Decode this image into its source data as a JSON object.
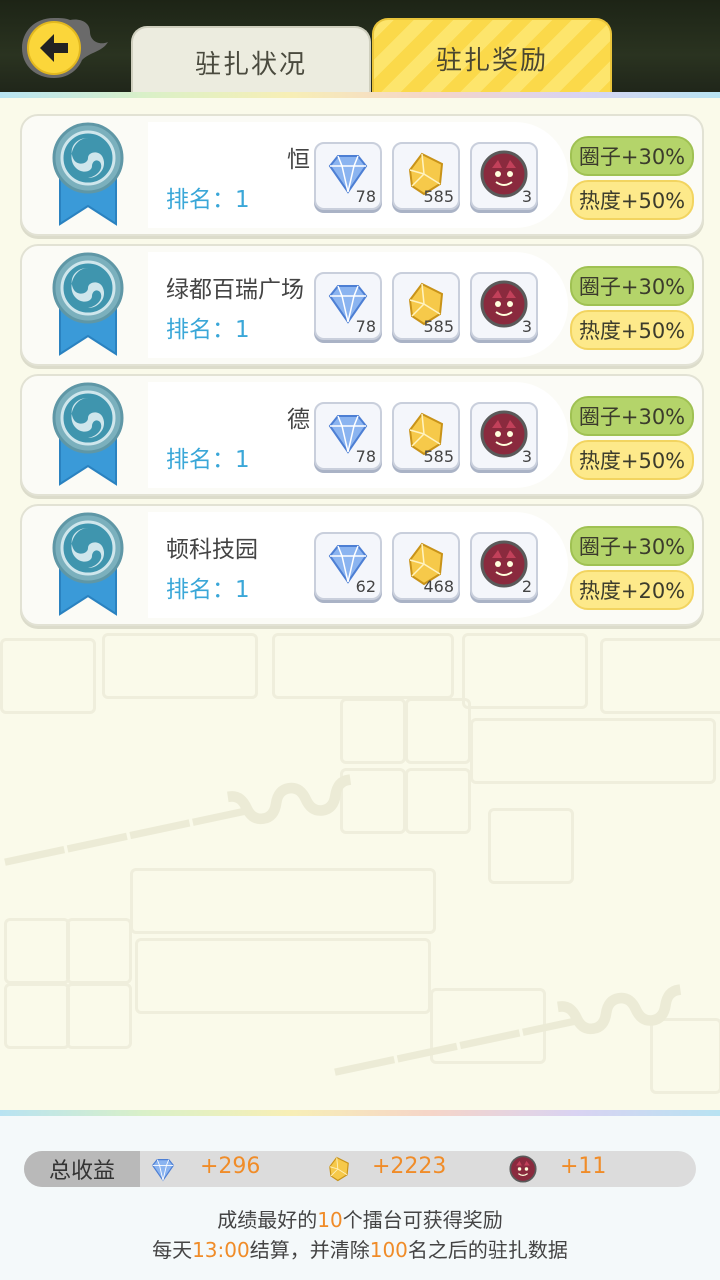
{
  "header": {
    "back_icon": "back-arrow-icon",
    "tabs": [
      {
        "label": "驻扎状况",
        "active": false
      },
      {
        "label": "驻扎奖励",
        "active": true
      }
    ]
  },
  "cards": [
    {
      "name": "恒",
      "rank_label": "排名：1",
      "items": [
        {
          "icon": "diamond-icon",
          "qty": "78"
        },
        {
          "icon": "gold-crystal-icon",
          "qty": "585"
        },
        {
          "icon": "monster-token-icon",
          "qty": "3"
        }
      ],
      "bonus_circle": "圈子+30%",
      "bonus_heat": "热度+50%"
    },
    {
      "name": "绿都百瑞广场",
      "rank_label": "排名：1",
      "items": [
        {
          "icon": "diamond-icon",
          "qty": "78"
        },
        {
          "icon": "gold-crystal-icon",
          "qty": "585"
        },
        {
          "icon": "monster-token-icon",
          "qty": "3"
        }
      ],
      "bonus_circle": "圈子+30%",
      "bonus_heat": "热度+50%"
    },
    {
      "name": "德",
      "rank_label": "排名：1",
      "items": [
        {
          "icon": "diamond-icon",
          "qty": "78"
        },
        {
          "icon": "gold-crystal-icon",
          "qty": "585"
        },
        {
          "icon": "monster-token-icon",
          "qty": "3"
        }
      ],
      "bonus_circle": "圈子+30%",
      "bonus_heat": "热度+50%"
    },
    {
      "name": "顿科技园",
      "rank_label": "排名：1",
      "items": [
        {
          "icon": "diamond-icon",
          "qty": "62"
        },
        {
          "icon": "gold-crystal-icon",
          "qty": "468"
        },
        {
          "icon": "monster-token-icon",
          "qty": "2"
        }
      ],
      "bonus_circle": "圈子+30%",
      "bonus_heat": "热度+20%"
    }
  ],
  "footer": {
    "total_label": "总收益",
    "totals": [
      {
        "icon": "diamond-icon",
        "value": "+296"
      },
      {
        "icon": "gold-crystal-icon",
        "value": "+2223"
      },
      {
        "icon": "monster-token-icon",
        "value": "+11"
      }
    ],
    "note1": {
      "a": "成绩最好的",
      "b": "10",
      "c": "个擂台可获得奖励"
    },
    "note2": {
      "a": "每天",
      "b": "13:00",
      "c": "结算，并清除",
      "d": "100",
      "e": "名之后的驻扎数据"
    }
  },
  "colors": {
    "accent": "#fbd94a",
    "rank_text": "#3aa7d8",
    "highlight": "#f08c28",
    "bonus_circle": "#b4d46a",
    "bonus_heat": "#fde98a"
  }
}
